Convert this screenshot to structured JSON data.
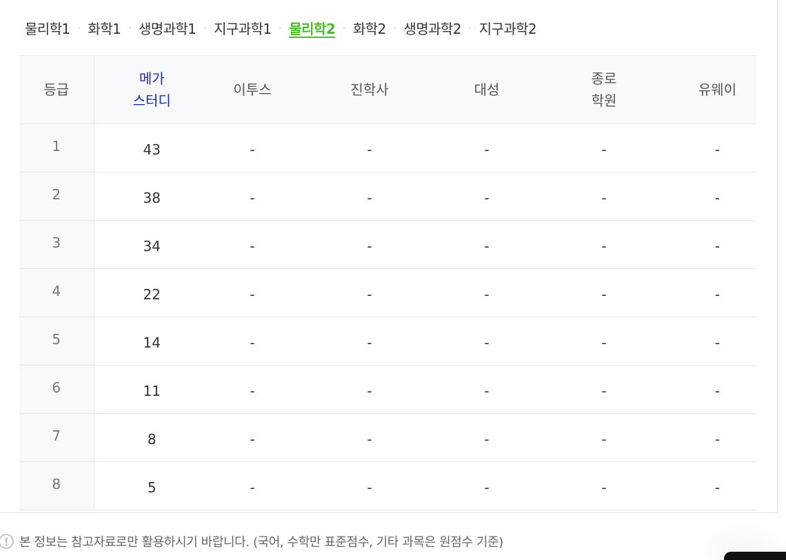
{
  "tabs": [
    {
      "label": "물리학1",
      "active": false
    },
    {
      "label": "화학1",
      "active": false
    },
    {
      "label": "생명과학1",
      "active": false
    },
    {
      "label": "지구과학1",
      "active": false
    },
    {
      "label": "물리학2",
      "active": true
    },
    {
      "label": "화학2",
      "active": false
    },
    {
      "label": "생명과학2",
      "active": false
    },
    {
      "label": "지구과학2",
      "active": false
    }
  ],
  "separator": "·",
  "table": {
    "headers": {
      "grade": "등급",
      "mega_line1": "메가",
      "mega_line2": "스터디",
      "etoos": "이투스",
      "jinhaksa": "진학사",
      "daesung": "대성",
      "jongro_line1": "종로",
      "jongro_line2": "학원",
      "uway": "유웨이"
    },
    "rows": [
      {
        "grade": "1",
        "mega": "43",
        "etoos": "-",
        "jinhaksa": "-",
        "daesung": "-",
        "jongro": "-",
        "uway": "-"
      },
      {
        "grade": "2",
        "mega": "38",
        "etoos": "-",
        "jinhaksa": "-",
        "daesung": "-",
        "jongro": "-",
        "uway": "-"
      },
      {
        "grade": "3",
        "mega": "34",
        "etoos": "-",
        "jinhaksa": "-",
        "daesung": "-",
        "jongro": "-",
        "uway": "-"
      },
      {
        "grade": "4",
        "mega": "22",
        "etoos": "-",
        "jinhaksa": "-",
        "daesung": "-",
        "jongro": "-",
        "uway": "-"
      },
      {
        "grade": "5",
        "mega": "14",
        "etoos": "-",
        "jinhaksa": "-",
        "daesung": "-",
        "jongro": "-",
        "uway": "-"
      },
      {
        "grade": "6",
        "mega": "11",
        "etoos": "-",
        "jinhaksa": "-",
        "daesung": "-",
        "jongro": "-",
        "uway": "-"
      },
      {
        "grade": "7",
        "mega": "8",
        "etoos": "-",
        "jinhaksa": "-",
        "daesung": "-",
        "jongro": "-",
        "uway": "-"
      },
      {
        "grade": "8",
        "mega": "5",
        "etoos": "-",
        "jinhaksa": "-",
        "daesung": "-",
        "jongro": "-",
        "uway": "-"
      }
    ]
  },
  "notice": {
    "icon": "exclamation-circle-icon",
    "icon_glyph": "!",
    "text": "본 정보는 참고자료로만 활용하시기 바랍니다. (국어, 수학만 표준점수, 기타 과목은 원점수 기준)"
  },
  "colors": {
    "active_tab": "#4cb92f",
    "mega_header": "#1f2bb0"
  }
}
